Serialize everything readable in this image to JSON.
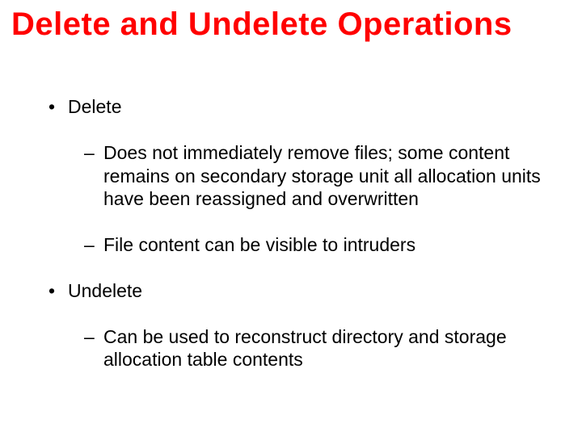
{
  "title": "Delete and Undelete Operations",
  "bullets": {
    "b1": "Delete",
    "b1a": "Does not immediately remove files; some content remains on secondary storage unit all allocation units have been reassigned and overwritten",
    "b1b": "File content can be visible to intruders",
    "b2": "Undelete",
    "b2a": "Can be used to reconstruct directory and storage allocation table contents"
  }
}
